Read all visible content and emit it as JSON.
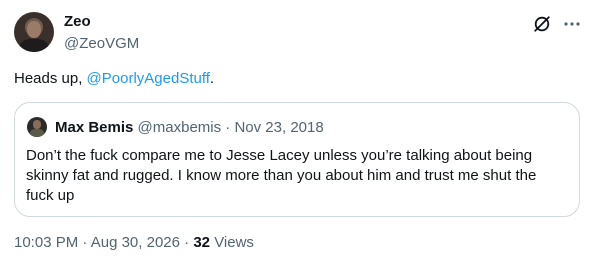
{
  "author": {
    "display_name": "Zeo",
    "handle": "@ZeoVGM"
  },
  "tweet": {
    "text_prefix": "Heads up, ",
    "mention": "@PoorlyAgedStuff",
    "text_suffix": "."
  },
  "quote": {
    "display_name": "Max Bemis",
    "handle": "@maxbemis",
    "separator": "·",
    "date": "Nov 23, 2018",
    "text": "Don’t the fuck compare me to Jesse Lacey unless you’re talking about being skinny fat and rugged. I know more than you about him and trust me shut the fuck up"
  },
  "footer": {
    "time": "10:03 PM",
    "separator": "·",
    "date": "Aug 30, 2026",
    "views_count": "32",
    "views_label": "Views"
  },
  "icons": {
    "grok": "grok-icon",
    "more": "more-icon"
  },
  "colors": {
    "link": "#1d9bf0",
    "secondary_text": "#536471",
    "primary_text": "#0f1419",
    "border": "#cfd9de"
  }
}
